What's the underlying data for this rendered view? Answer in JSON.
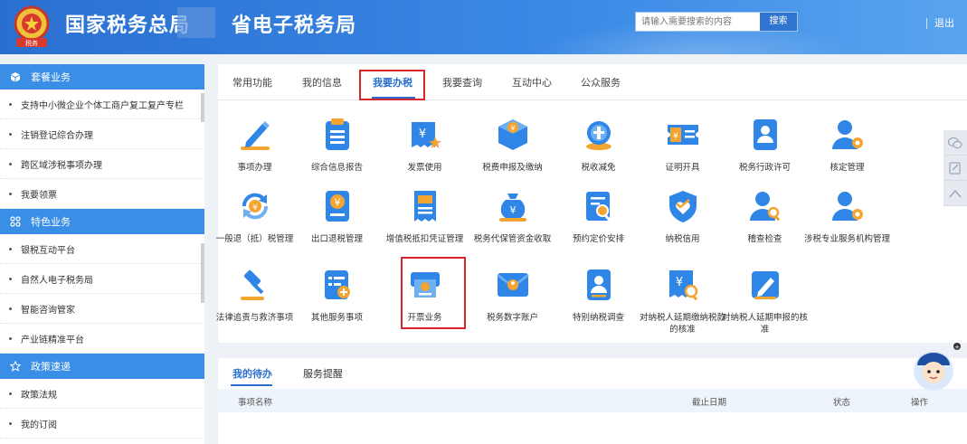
{
  "header": {
    "title_left": "国家税务总局",
    "title_right": "省电子税务局",
    "emblem_text": "税务",
    "search_placeholder": "请输入需要搜索的内容",
    "search_button": "搜索",
    "logout": "退出"
  },
  "sidebar": {
    "sections": [
      {
        "title": "套餐业务",
        "icon": "cube-icon",
        "items": [
          "支持中小微企业个体工商户复工复产专栏",
          "注销登记综合办理",
          "跨区域涉税事项办理",
          "我要领票"
        ]
      },
      {
        "title": "特色业务",
        "icon": "grid-icon",
        "items": [
          "银税互动平台",
          "自然人电子税务局",
          "智能咨询管家",
          "产业链精准平台"
        ]
      },
      {
        "title": "政策速递",
        "icon": "star-icon",
        "items": [
          "政策法规",
          "我的订阅"
        ]
      }
    ]
  },
  "tabs": [
    "常用功能",
    "我的信息",
    "我要办税",
    "我要查询",
    "互动中心",
    "公众服务"
  ],
  "active_tab": "我要办税",
  "services": [
    {
      "label": "事项办理",
      "icon": "pen-icon"
    },
    {
      "label": "综合信息报告",
      "icon": "clipboard-icon"
    },
    {
      "label": "发票使用",
      "icon": "invoice-star-icon"
    },
    {
      "label": "税费申报及缴纳",
      "icon": "yuan-box-icon"
    },
    {
      "label": "税收减免",
      "icon": "coins-icon"
    },
    {
      "label": "证明开具",
      "icon": "ticket-icon"
    },
    {
      "label": "税务行政许可",
      "icon": "id-card-icon"
    },
    {
      "label": "核定管理",
      "icon": "user-gear-icon"
    },
    {
      "label": "一般退（抵）税管理",
      "icon": "yuan-refresh-icon"
    },
    {
      "label": "出口退税管理",
      "icon": "yuan-book-icon"
    },
    {
      "label": "增值税抵扣凭证管理",
      "icon": "receipt-icon"
    },
    {
      "label": "税务代保管资金收取",
      "icon": "money-bag-icon"
    },
    {
      "label": "预约定价安排",
      "icon": "doc-search-icon"
    },
    {
      "label": "纳税信用",
      "icon": "shield-heart-icon"
    },
    {
      "label": "稽查检查",
      "icon": "inspector-icon"
    },
    {
      "label": "涉税专业服务机构管理",
      "icon": "user-gear-icon"
    },
    {
      "label": "法律追责与救济事项",
      "icon": "gavel-icon"
    },
    {
      "label": "其他服务事项",
      "icon": "list-add-icon"
    },
    {
      "label": "开票业务",
      "icon": "invoice-print-icon"
    },
    {
      "label": "税务数字账户",
      "icon": "envelope-icon"
    },
    {
      "label": "特别纳税调查",
      "icon": "person-card-icon"
    },
    {
      "label": "对纳税人延期缴纳税款的核准",
      "icon": "yuan-search-icon"
    },
    {
      "label": "对纳税人延期申报的核准",
      "icon": "edit-icon"
    }
  ],
  "todo": {
    "tabs": [
      "我的待办",
      "服务提醒"
    ],
    "columns": [
      "事项名称",
      "截止日期",
      "状态",
      "操作"
    ]
  },
  "colors": {
    "brand_blue": "#2a6fd0",
    "icon_blue": "#2f86e6",
    "icon_orange": "#f4a531",
    "highlight_red": "#d8252b"
  }
}
